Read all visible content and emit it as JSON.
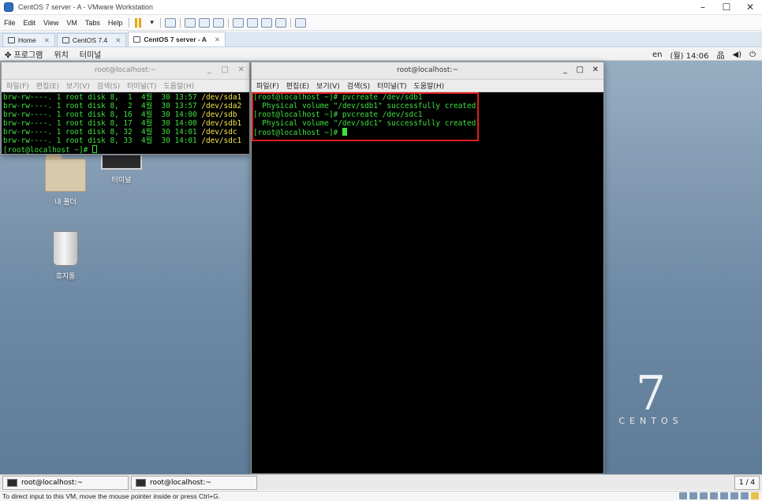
{
  "window": {
    "title": "CentOS 7 server - A - VMware Workstation",
    "controls": {
      "minimize": "–",
      "maximize": "☐",
      "close": "✕"
    }
  },
  "menubar": {
    "items": [
      "File",
      "Edit",
      "View",
      "VM",
      "Tabs",
      "Help"
    ]
  },
  "tabs": [
    {
      "label": "Home",
      "active": false
    },
    {
      "label": "CentOS 7.4",
      "active": false
    },
    {
      "label": "CentOS 7 server - A",
      "active": true
    }
  ],
  "gnome_topbar": {
    "apps": "프로그램",
    "places": "위치",
    "terminal": "터미널",
    "lang": "en",
    "clock": "(월) 14:06"
  },
  "desktop": {
    "home_label": "내 폴더",
    "terminal_label": "터미널",
    "trash_label": "휴지통",
    "logo_number": "7",
    "logo_word": "CENTOS"
  },
  "terminal_left": {
    "title": "root@localhost:~",
    "menu": [
      "파일(F)",
      "편집(E)",
      "보기(V)",
      "검색(S)",
      "터미널(T)",
      "도움말(H)"
    ],
    "lines": [
      {
        "text": "brw-rw----. 1 root disk 8,  1  4월  30 13:57 ",
        "dev": "/dev/sda1"
      },
      {
        "text": "brw-rw----. 1 root disk 8,  2  4월  30 13:57 ",
        "dev": "/dev/sda2"
      },
      {
        "text": "brw-rw----. 1 root disk 8, 16  4월  30 14:00 ",
        "dev": "/dev/sdb"
      },
      {
        "text": "brw-rw----. 1 root disk 8, 17  4월  30 14:00 ",
        "dev": "/dev/sdb1"
      },
      {
        "text": "brw-rw----. 1 root disk 8, 32  4월  30 14:01 ",
        "dev": "/dev/sdc"
      },
      {
        "text": "brw-rw----. 1 root disk 8, 33  4월  30 14:01 ",
        "dev": "/dev/sdc1"
      }
    ],
    "prompt": "[root@localhost ~]# "
  },
  "terminal_right": {
    "title": "root@localhost:~",
    "menu": [
      "파일(F)",
      "편집(E)",
      "보기(V)",
      "검색(S)",
      "터미널(T)",
      "도움말(H)"
    ],
    "lines": [
      "[root@localhost ~]# pvcreate /dev/sdb1",
      "  Physical volume \"/dev/sdb1\" successfully created.",
      "[root@localhost ~]# pvcreate /dev/sdc1",
      "  Physical volume \"/dev/sdc1\" successfully created.",
      "[root@localhost ~]# "
    ]
  },
  "tasklist": {
    "tasks": [
      "root@localhost:~",
      "root@localhost:~"
    ],
    "workspace": "1 / 4"
  },
  "statusbar": {
    "text": "To direct input to this VM, move the mouse pointer inside or press Ctrl+G."
  }
}
